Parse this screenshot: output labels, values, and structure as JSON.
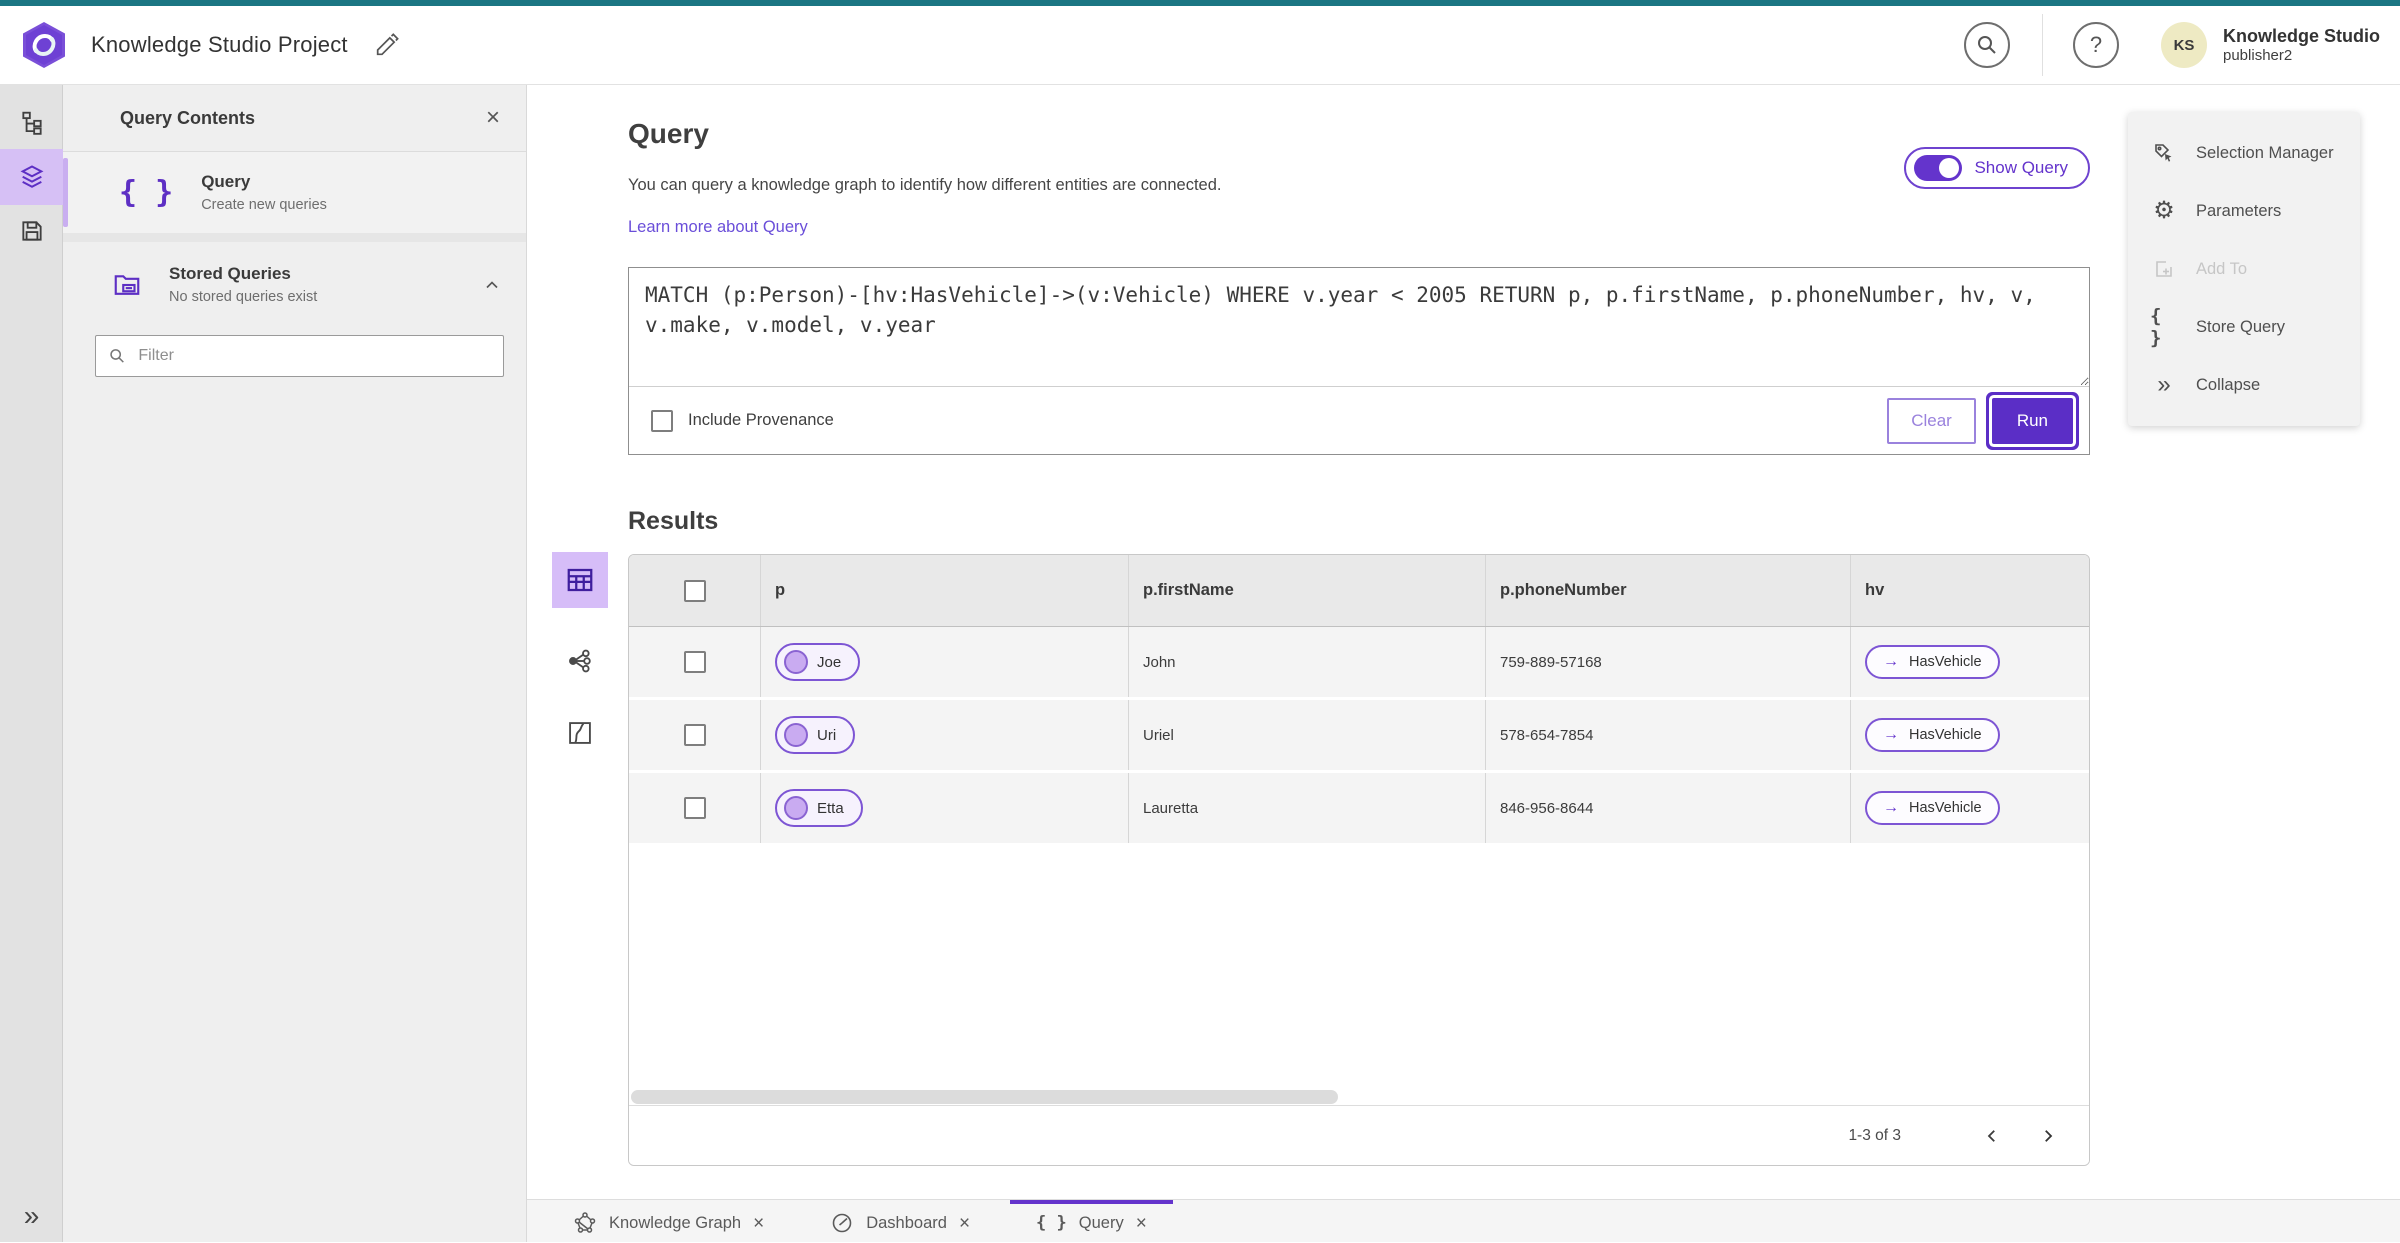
{
  "topbar": {
    "title": "Knowledge Studio Project",
    "avatar_initials": "KS",
    "user_name": "Knowledge Studio",
    "user_role": "publisher2"
  },
  "icons": {
    "close": "×",
    "help": "?",
    "braces": "{ }",
    "arrow_right": "→",
    "collapse": "»",
    "gear": "⚙"
  },
  "panel": {
    "title": "Query Contents",
    "query_item": {
      "title": "Query",
      "subtitle": "Create new queries"
    },
    "stored_queries": {
      "title": "Stored Queries",
      "subtitle": "No stored queries exist"
    },
    "filter_placeholder": "Filter"
  },
  "query_section": {
    "title": "Query",
    "description": "You can query a knowledge graph to identify how different entities are connected.",
    "learn_more": "Learn more about Query",
    "show_query": "Show Query",
    "query_text": "MATCH (p:Person)-[hv:HasVehicle]->(v:Vehicle) WHERE v.year < 2005 RETURN p, p.firstName, p.phoneNumber, hv, v, v.make, v.model, v.year",
    "include_provenance": "Include Provenance",
    "clear": "Clear",
    "run": "Run"
  },
  "results": {
    "title": "Results",
    "columns": [
      "p",
      "p.firstName",
      "p.phoneNumber",
      "hv"
    ],
    "rows": [
      {
        "p": "Joe",
        "firstName": "John",
        "phoneNumber": "759-889-57168",
        "hv": "HasVehicle"
      },
      {
        "p": "Uri",
        "firstName": "Uriel",
        "phoneNumber": "578-654-7854",
        "hv": "HasVehicle"
      },
      {
        "p": "Etta",
        "firstName": "Lauretta",
        "phoneNumber": "846-956-8644",
        "hv": "HasVehicle"
      }
    ],
    "pagination": "1-3 of 3"
  },
  "right_panel": {
    "items": [
      {
        "label": "Selection Manager"
      },
      {
        "label": "Parameters"
      },
      {
        "label": "Add To",
        "disabled": true
      },
      {
        "label": "Store Query"
      },
      {
        "label": "Collapse"
      }
    ]
  },
  "tabs": [
    {
      "label": "Knowledge Graph"
    },
    {
      "label": "Dashboard"
    },
    {
      "label": "Query",
      "active": true
    }
  ],
  "colors": {
    "accent": "#5d2fc4",
    "accent_light": "#d6c0f5",
    "teal_top": "#1b7683",
    "link": "#6a4ed9"
  }
}
